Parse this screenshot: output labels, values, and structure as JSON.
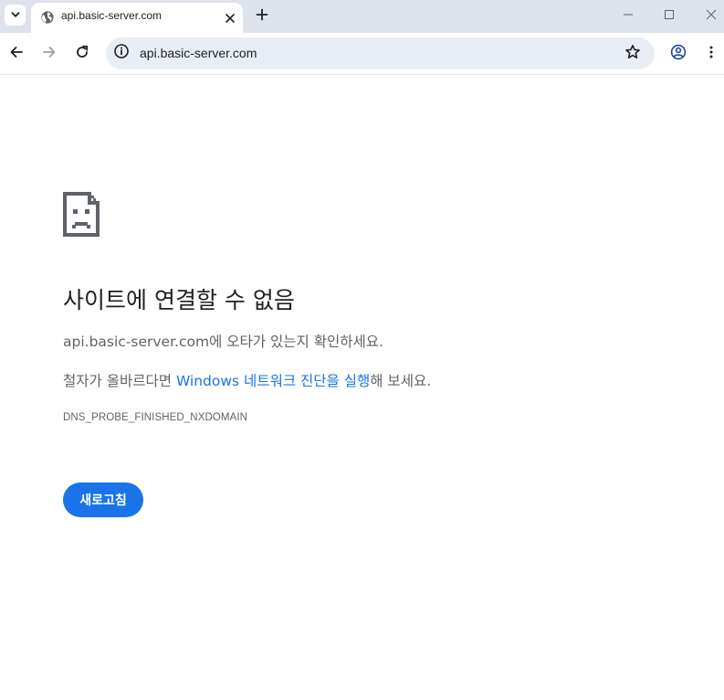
{
  "browser": {
    "tab": {
      "title": "api.basic-server.com",
      "favicon": "globe-icon"
    },
    "omnibox": {
      "url": "api.basic-server.com"
    },
    "icons": {
      "tab_search": "chevron-down-icon",
      "tab_close": "close-icon",
      "new_tab": "plus-icon",
      "minimize": "minimize-icon",
      "maximize": "maximize-icon",
      "close_window": "close-icon",
      "back": "arrow-left-icon",
      "forward": "arrow-right-icon",
      "reload": "reload-icon",
      "site_info": "info-icon",
      "bookmark": "star-icon",
      "profile": "profile-icon",
      "menu": "kebab-menu-icon"
    },
    "colors": {
      "tabstrip": "#dee3eb",
      "omnibox": "#e9eef6",
      "accent": "#1a73e8"
    }
  },
  "error_page": {
    "icon": "sad-page-icon",
    "heading": "사이트에 연결할 수 없음",
    "typo_host": "api.basic-server.com",
    "typo_suffix": "에 오타가 있는지 확인하세요.",
    "diag_prefix": "철자가 올바르다면 ",
    "diag_link": "Windows 네트워크 진단을 실행",
    "diag_suffix": "해 보세요.",
    "error_code": "DNS_PROBE_FINISHED_NXDOMAIN",
    "reload_button": "새로고침"
  }
}
